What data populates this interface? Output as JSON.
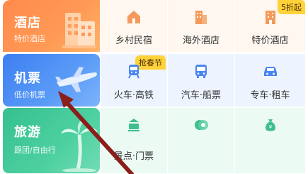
{
  "hotel": {
    "title": "酒店",
    "subtitle": "特价酒店",
    "items": [
      {
        "label": "乡村民宿",
        "icon": "house-icon"
      },
      {
        "label": "海外酒店",
        "icon": "building-icon"
      },
      {
        "label": "特价酒店",
        "icon": "building-icon",
        "badge": "5折起"
      }
    ]
  },
  "flight": {
    "title": "机票",
    "subtitle": "低价机票",
    "items": [
      {
        "label": "火车·高铁",
        "icon": "train-icon",
        "badge": "抢春节"
      },
      {
        "label": "汽车·船票",
        "icon": "bus-icon"
      },
      {
        "label": "专车·租车",
        "icon": "car-icon"
      }
    ]
  },
  "travel": {
    "title": "旅游",
    "subtitle": "跟团/自由行",
    "items": [
      {
        "label": "景点·门票",
        "icon": "ticket-icon"
      },
      {
        "label": "",
        "icon": "coin-icon"
      },
      {
        "label": "",
        "icon": "money-bag-icon"
      }
    ]
  },
  "colors": {
    "hotel": "#ff8a4c",
    "flight": "#3d7ff2",
    "travel": "#36c08f",
    "badge": "#ffd23a",
    "arrow": "#8b1e1a"
  }
}
